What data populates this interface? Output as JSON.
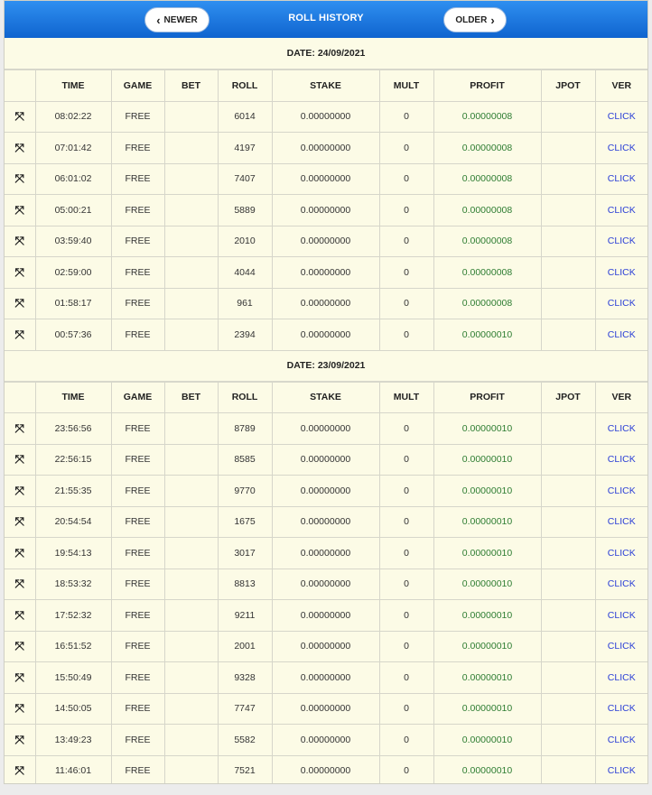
{
  "header": {
    "title": "ROLL HISTORY",
    "newer_label": "NEWER",
    "older_label": "OLDER"
  },
  "columns": [
    "TIME",
    "GAME",
    "BET",
    "ROLL",
    "STAKE",
    "MULT",
    "PROFIT",
    "JPOT",
    "VER"
  ],
  "groups": [
    {
      "date_label": "DATE: 24/09/2021",
      "rows": [
        {
          "time": "08:02:22",
          "game": "FREE",
          "bet": "",
          "roll": "6014",
          "stake": "0.00000000",
          "mult": "0",
          "profit": "0.00000008",
          "jpot": "",
          "ver": "CLICK"
        },
        {
          "time": "07:01:42",
          "game": "FREE",
          "bet": "",
          "roll": "4197",
          "stake": "0.00000000",
          "mult": "0",
          "profit": "0.00000008",
          "jpot": "",
          "ver": "CLICK"
        },
        {
          "time": "06:01:02",
          "game": "FREE",
          "bet": "",
          "roll": "7407",
          "stake": "0.00000000",
          "mult": "0",
          "profit": "0.00000008",
          "jpot": "",
          "ver": "CLICK"
        },
        {
          "time": "05:00:21",
          "game": "FREE",
          "bet": "",
          "roll": "5889",
          "stake": "0.00000000",
          "mult": "0",
          "profit": "0.00000008",
          "jpot": "",
          "ver": "CLICK"
        },
        {
          "time": "03:59:40",
          "game": "FREE",
          "bet": "",
          "roll": "2010",
          "stake": "0.00000000",
          "mult": "0",
          "profit": "0.00000008",
          "jpot": "",
          "ver": "CLICK"
        },
        {
          "time": "02:59:00",
          "game": "FREE",
          "bet": "",
          "roll": "4044",
          "stake": "0.00000000",
          "mult": "0",
          "profit": "0.00000008",
          "jpot": "",
          "ver": "CLICK"
        },
        {
          "time": "01:58:17",
          "game": "FREE",
          "bet": "",
          "roll": "961",
          "stake": "0.00000000",
          "mult": "0",
          "profit": "0.00000008",
          "jpot": "",
          "ver": "CLICK"
        },
        {
          "time": "00:57:36",
          "game": "FREE",
          "bet": "",
          "roll": "2394",
          "stake": "0.00000000",
          "mult": "0",
          "profit": "0.00000010",
          "jpot": "",
          "ver": "CLICK"
        }
      ]
    },
    {
      "date_label": "DATE: 23/09/2021",
      "rows": [
        {
          "time": "23:56:56",
          "game": "FREE",
          "bet": "",
          "roll": "8789",
          "stake": "0.00000000",
          "mult": "0",
          "profit": "0.00000010",
          "jpot": "",
          "ver": "CLICK"
        },
        {
          "time": "22:56:15",
          "game": "FREE",
          "bet": "",
          "roll": "8585",
          "stake": "0.00000000",
          "mult": "0",
          "profit": "0.00000010",
          "jpot": "",
          "ver": "CLICK"
        },
        {
          "time": "21:55:35",
          "game": "FREE",
          "bet": "",
          "roll": "9770",
          "stake": "0.00000000",
          "mult": "0",
          "profit": "0.00000010",
          "jpot": "",
          "ver": "CLICK"
        },
        {
          "time": "20:54:54",
          "game": "FREE",
          "bet": "",
          "roll": "1675",
          "stake": "0.00000000",
          "mult": "0",
          "profit": "0.00000010",
          "jpot": "",
          "ver": "CLICK"
        },
        {
          "time": "19:54:13",
          "game": "FREE",
          "bet": "",
          "roll": "3017",
          "stake": "0.00000000",
          "mult": "0",
          "profit": "0.00000010",
          "jpot": "",
          "ver": "CLICK"
        },
        {
          "time": "18:53:32",
          "game": "FREE",
          "bet": "",
          "roll": "8813",
          "stake": "0.00000000",
          "mult": "0",
          "profit": "0.00000010",
          "jpot": "",
          "ver": "CLICK"
        },
        {
          "time": "17:52:32",
          "game": "FREE",
          "bet": "",
          "roll": "9211",
          "stake": "0.00000000",
          "mult": "0",
          "profit": "0.00000010",
          "jpot": "",
          "ver": "CLICK"
        },
        {
          "time": "16:51:52",
          "game": "FREE",
          "bet": "",
          "roll": "2001",
          "stake": "0.00000000",
          "mult": "0",
          "profit": "0.00000010",
          "jpot": "",
          "ver": "CLICK"
        },
        {
          "time": "15:50:49",
          "game": "FREE",
          "bet": "",
          "roll": "9328",
          "stake": "0.00000000",
          "mult": "0",
          "profit": "0.00000010",
          "jpot": "",
          "ver": "CLICK"
        },
        {
          "time": "14:50:05",
          "game": "FREE",
          "bet": "",
          "roll": "7747",
          "stake": "0.00000000",
          "mult": "0",
          "profit": "0.00000010",
          "jpot": "",
          "ver": "CLICK"
        },
        {
          "time": "13:49:23",
          "game": "FREE",
          "bet": "",
          "roll": "5582",
          "stake": "0.00000000",
          "mult": "0",
          "profit": "0.00000010",
          "jpot": "",
          "ver": "CLICK"
        },
        {
          "time": "11:46:01",
          "game": "FREE",
          "bet": "",
          "roll": "7521",
          "stake": "0.00000000",
          "mult": "0",
          "profit": "0.00000010",
          "jpot": "",
          "ver": "CLICK"
        }
      ]
    }
  ],
  "icons": {
    "row_icon": "expand-arrows-icon",
    "newer_icon": "chevron-left-icon",
    "older_icon": "chevron-right-icon"
  },
  "colors": {
    "header": "#1a73e0",
    "profit": "#2e7d32",
    "link": "#2b3fd6",
    "background": "#fcfbe6"
  }
}
